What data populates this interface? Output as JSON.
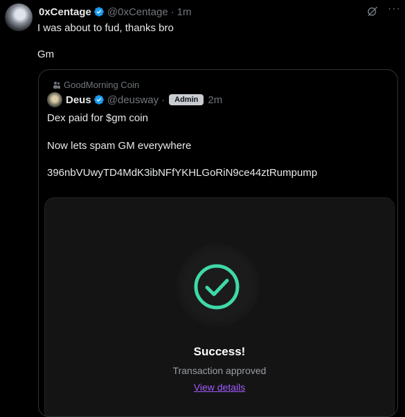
{
  "post": {
    "author_name": "0xCentage",
    "author_handle": "@0xCentage",
    "separator": "·",
    "time": "1m",
    "text_line1": "I was about to fud, thanks bro",
    "text_line2": "Gm"
  },
  "quote": {
    "community": "GoodMorning Coin",
    "author_name": "Deus",
    "author_handle": "@deusway",
    "separator": "·",
    "badge": "Admin",
    "time": "2m",
    "line1": "Dex paid for $gm coin",
    "line2": "Now lets spam GM everywhere",
    "line3": "396nbVUwyTD4MdK3ibNFfYKHLGoRiN9ce44ztRumpump"
  },
  "media": {
    "title": "Success!",
    "subtitle": "Transaction approved",
    "link": "View details",
    "accent_color": "#3fd9a8",
    "link_color": "#a35bff"
  },
  "icons": {
    "verified": "verified-badge-icon",
    "grok": "grok-icon",
    "more": "more-options-icon",
    "community": "community-icon",
    "check": "check-circle-icon"
  }
}
